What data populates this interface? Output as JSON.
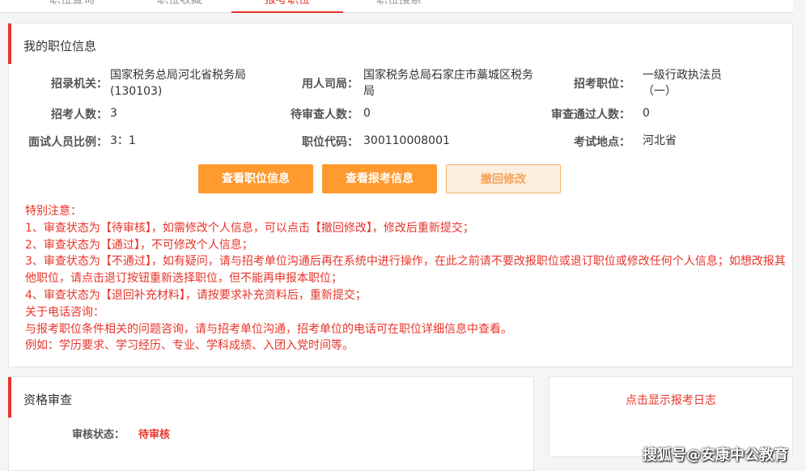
{
  "tabs": [
    {
      "label": "职位查询"
    },
    {
      "label": "职位收藏"
    },
    {
      "label": "报考职位"
    },
    {
      "label": "职位搜索"
    }
  ],
  "info": {
    "title": "我的职位信息",
    "fields": {
      "recruiting_org_label": "招录机关：",
      "recruiting_org_value": "国家税务总局河北省税务局(130103)",
      "employer_label": "用人司局：",
      "employer_value": "国家税务总局石家庄市藁城区税务局",
      "position_label": "招考职位：",
      "position_value": "一级行政执法员（一）",
      "headcount_label": "招考人数：",
      "headcount_value": "3",
      "pending_label": "待审查人数：",
      "pending_value": "0",
      "approved_label": "审查通过人数：",
      "approved_value": "0",
      "ratio_label": "面试人员比例：",
      "ratio_value": "3：1",
      "code_label": "职位代码：",
      "code_value": "300110008001",
      "location_label": "考试地点：",
      "location_value": "河北省"
    },
    "buttons": {
      "view_position": "查看职位信息",
      "view_application": "查看报考信息",
      "withdraw": "撤回修改"
    },
    "notes": [
      "特别注意：",
      "1、审查状态为【待审核】，如需修改个人信息，可以点击【撤回修改】，修改后重新提交；",
      "2、审查状态为【通过】，不可修改个人信息；",
      "3、审查状态为【不通过】，如有疑问，请与招考单位沟通后再在系统中进行操作，在此之前请不要改报职位或退订职位或修改任何个人信息；如想改报其他职位，请点击退订按钮重新选择职位，但不能再申报本职位；",
      "4、审查状态为【退回补充材料】，请按要求补充资料后，重新提交；",
      "关于电话咨询：",
      "与报考职位条件相关的问题咨询，请与招考单位沟通，招考单位的电话可在职位详细信息中查看。",
      "例如：学历要求、学习经历、专业、学科成绩、入团入党时间等。"
    ]
  },
  "qualification": {
    "title": "资格审查",
    "status_label": "审核状态：",
    "status_value": "待审核"
  },
  "log": {
    "link": "点击显示报考日志"
  },
  "watermark": "搜狐号@安康中公教育",
  "colors": {
    "accent_red": "#e8342a",
    "button_orange": "#ff9a2e",
    "button_light": "#fdeedd"
  }
}
